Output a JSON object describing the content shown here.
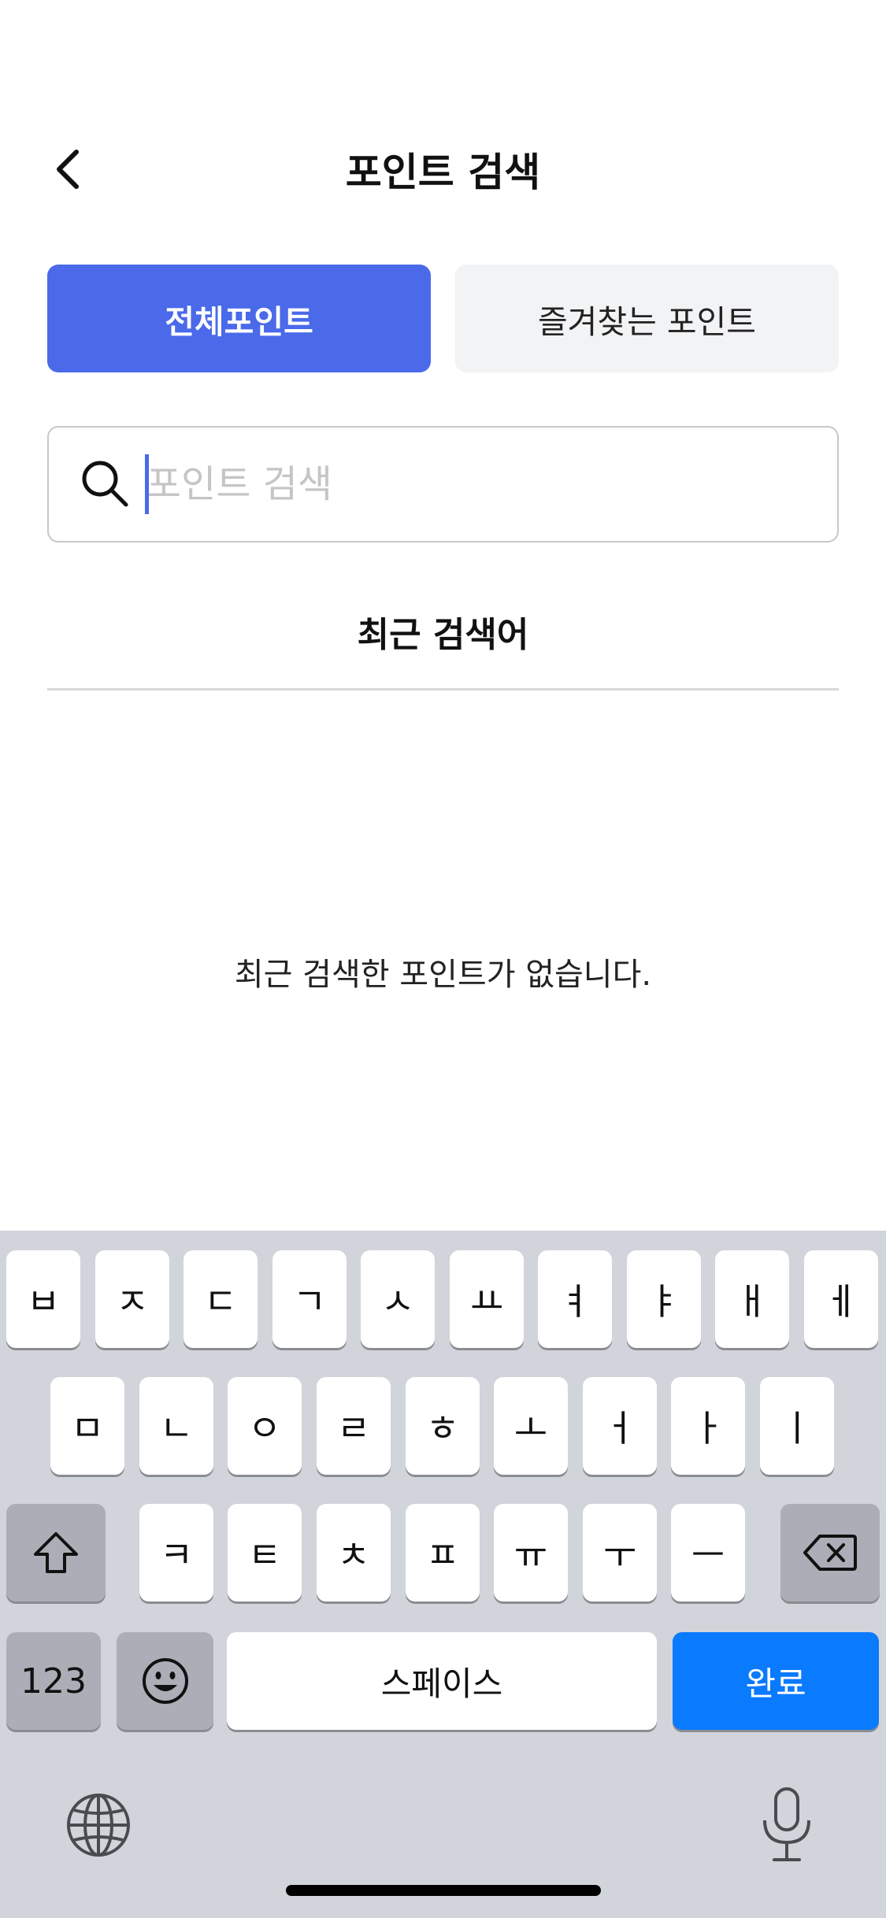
{
  "header": {
    "title": "포인트 검색",
    "back_icon": "chevron-left-icon"
  },
  "tabs": [
    {
      "label": "전체포인트",
      "active": true
    },
    {
      "label": "즐겨찾는 포인트",
      "active": false
    }
  ],
  "search": {
    "placeholder": "포인트 검색",
    "value": "",
    "icon": "search-icon"
  },
  "recent": {
    "title": "최근 검색어",
    "empty_message": "최근 검색한 포인트가 없습니다."
  },
  "keyboard": {
    "row1": [
      "ㅂ",
      "ㅈ",
      "ㄷ",
      "ㄱ",
      "ㅅ",
      "ㅛ",
      "ㅕ",
      "ㅑ",
      "ㅐ",
      "ㅔ"
    ],
    "row2": [
      "ㅁ",
      "ㄴ",
      "ㅇ",
      "ㄹ",
      "ㅎ",
      "ㅗ",
      "ㅓ",
      "ㅏ",
      "ㅣ"
    ],
    "row3": [
      "ㅋ",
      "ㅌ",
      "ㅊ",
      "ㅍ",
      "ㅠ",
      "ㅜ",
      "ㅡ"
    ],
    "numbers_label": "123",
    "space_label": "스페이스",
    "done_label": "완료"
  },
  "colors": {
    "accent": "#4a6ae9",
    "keyboard_done": "#0a7aff",
    "keyboard_bg": "#d1d4da"
  }
}
